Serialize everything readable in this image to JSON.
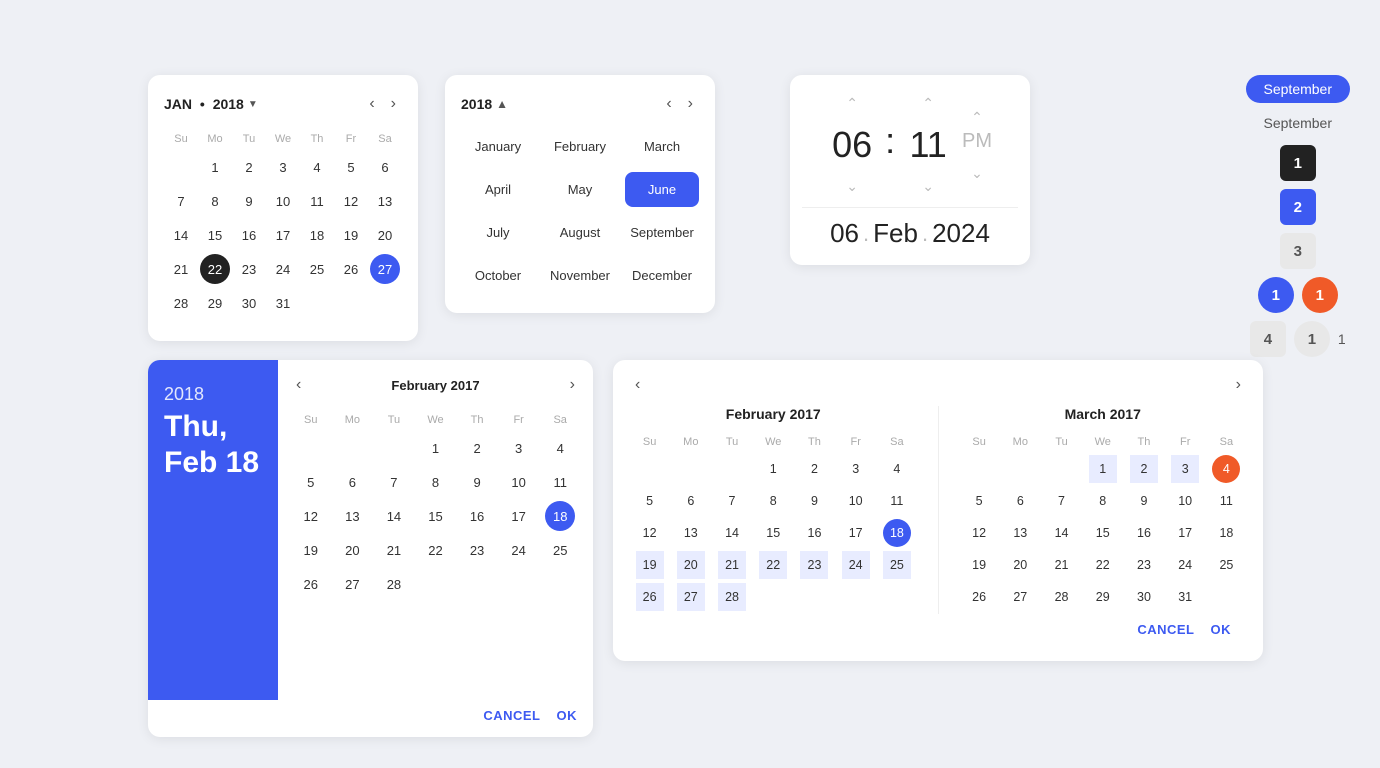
{
  "cal1": {
    "title": "JAN",
    "year": "2018",
    "days_header": [
      "Su",
      "Mo",
      "Tu",
      "We",
      "Th",
      "Fr",
      "Sa"
    ],
    "weeks": [
      [
        null,
        1,
        2,
        3,
        4,
        5,
        6
      ],
      [
        7,
        8,
        9,
        10,
        11,
        12,
        13
      ],
      [
        14,
        15,
        16,
        17,
        18,
        19,
        20
      ],
      [
        21,
        22,
        23,
        24,
        25,
        26,
        27
      ],
      [
        28,
        29,
        30,
        31,
        null,
        null,
        null
      ]
    ],
    "selected": 22,
    "selected_end": 27
  },
  "cal2": {
    "year": "2018",
    "months": [
      "January",
      "February",
      "March",
      "April",
      "May",
      "June",
      "July",
      "August",
      "September",
      "October",
      "November",
      "December"
    ],
    "active": "June"
  },
  "timepicker": {
    "hour": "06",
    "minute": "11",
    "ampm": "PM",
    "date_day": "06",
    "date_month": "Feb",
    "date_year": "2024"
  },
  "monthbadges": {
    "pill_label": "September",
    "label": "September",
    "row1": {
      "num": "1",
      "type": "dark"
    },
    "row2": {
      "num": "2",
      "type": "blue"
    },
    "row3": {
      "num": "3",
      "type": "gray"
    },
    "row4": {
      "num": "4",
      "type": "gray"
    },
    "circle_blue": "1",
    "circle_orange": "1",
    "circle_gray": "1",
    "plain": "1"
  },
  "datepicker1": {
    "year": "2018",
    "date_label": "Thu, Feb 18",
    "month_title": "February 2017",
    "days_header": [
      "Su",
      "Mo",
      "Tu",
      "We",
      "Th",
      "Fr",
      "Sa"
    ],
    "weeks": [
      [
        null,
        null,
        null,
        1,
        2,
        3,
        4
      ],
      [
        5,
        6,
        7,
        8,
        9,
        10,
        11
      ],
      [
        12,
        13,
        14,
        15,
        16,
        17,
        18
      ],
      [
        19,
        20,
        21,
        22,
        23,
        24,
        25
      ],
      [
        26,
        27,
        28,
        null,
        null,
        null,
        null
      ]
    ],
    "selected": 18,
    "cancel_label": "CANCEL",
    "ok_label": "OK"
  },
  "datepicker2": {
    "cal1": {
      "month_title": "February 2017",
      "days_header": [
        "Su",
        "Mo",
        "Tu",
        "We",
        "Th",
        "Fr",
        "Sa"
      ],
      "weeks": [
        [
          null,
          null,
          null,
          1,
          2,
          3,
          4
        ],
        [
          5,
          6,
          7,
          8,
          9,
          10,
          11
        ],
        [
          12,
          13,
          14,
          15,
          16,
          17,
          18
        ],
        [
          19,
          20,
          21,
          22,
          23,
          24,
          25
        ],
        [
          26,
          27,
          28,
          null,
          null,
          null,
          null
        ]
      ],
      "selected_start": 18,
      "range": [
        19,
        20,
        21,
        22,
        23,
        24,
        25,
        26,
        27,
        28
      ]
    },
    "cal2": {
      "month_title": "March 2017",
      "days_header": [
        "Su",
        "Mo",
        "Tu",
        "We",
        "Th",
        "Fr",
        "Sa"
      ],
      "weeks": [
        [
          null,
          null,
          null,
          1,
          2,
          3,
          4
        ],
        [
          5,
          6,
          7,
          8,
          9,
          10,
          11
        ],
        [
          12,
          13,
          14,
          15,
          16,
          17,
          18
        ],
        [
          19,
          20,
          21,
          22,
          23,
          24,
          25
        ],
        [
          26,
          27,
          28,
          29,
          30,
          31,
          null
        ]
      ],
      "selected_end": 4,
      "range_before": [
        1,
        2,
        3
      ]
    },
    "cancel_label": "CANCEL",
    "ok_label": "OK"
  }
}
